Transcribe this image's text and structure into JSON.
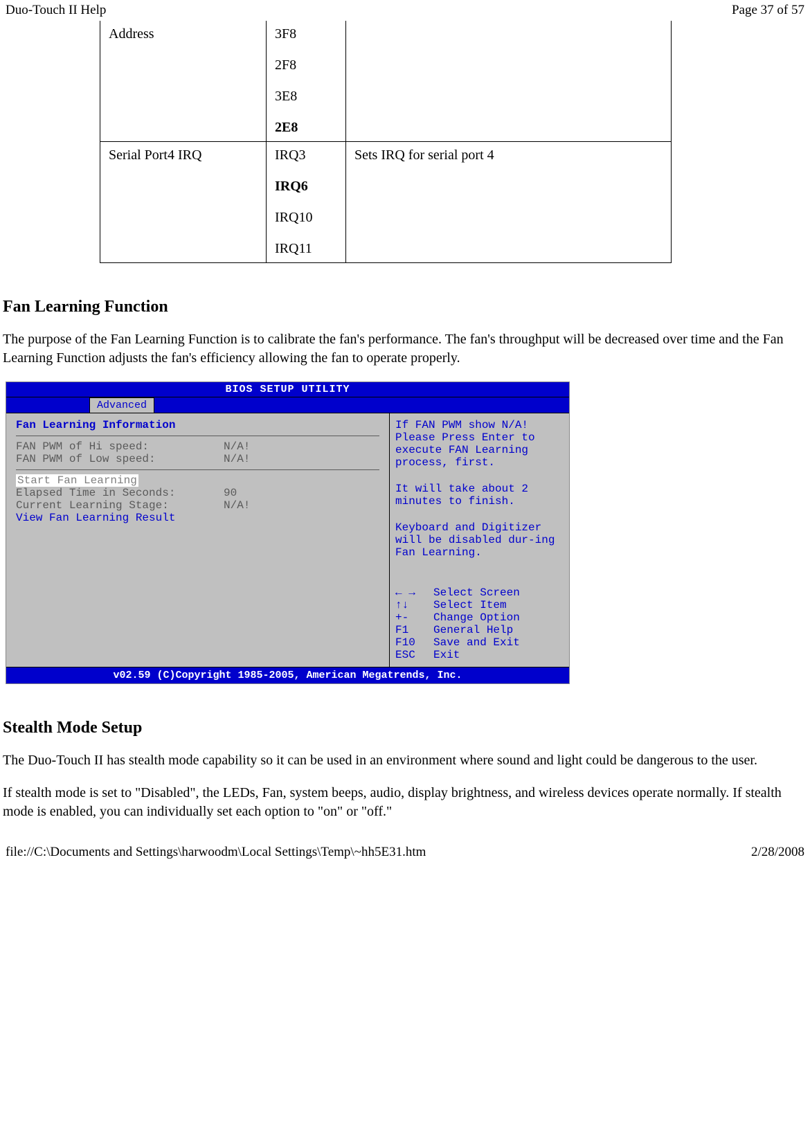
{
  "header": {
    "title": "Duo-Touch II Help",
    "page_info": "Page 37 of 57"
  },
  "table": {
    "row1": {
      "c1": "Address",
      "opts": {
        "o1": "3F8",
        "o2": "2F8",
        "o3": "3E8",
        "o4": "2E8"
      },
      "c3": ""
    },
    "row2": {
      "c1": "Serial Port4 IRQ",
      "opts": {
        "o1": "IRQ3",
        "o2": "IRQ6",
        "o3": "IRQ10",
        "o4": "IRQ11"
      },
      "c3": "Sets IRQ for serial port 4"
    }
  },
  "section1": {
    "heading": "Fan Learning Function",
    "p1": "The purpose of the Fan Learning Function is to calibrate the fan's performance.  The fan's throughput will be decreased over time and the Fan Learning Function adjusts the fan's efficiency allowing the fan to operate properly."
  },
  "bios": {
    "title": "BIOS SETUP UTILITY",
    "tab": "Advanced",
    "panel_title": "Fan Learning Information",
    "r1_label": "FAN PWM of Hi  speed:",
    "r1_val": "N/A!",
    "r2_label": "FAN PWM of Low speed:",
    "r2_val": "N/A!",
    "start": "Start Fan Learning",
    "r3_label": "Elapsed Time in Seconds:",
    "r3_val": "90",
    "r4_label": "Current Learning Stage:",
    "r4_val": "N/A!",
    "view": "View Fan Learning Result",
    "help1": "If FAN PWM show N/A! Please Press Enter to execute FAN Learning process, first.",
    "help2": "It will take about 2 minutes to finish.",
    "help3": "Keyboard and Digitizer will be disabled dur-ing Fan Learning.",
    "k1a": "← →",
    "k1b": "Select Screen",
    "k2a": "↑↓",
    "k2b": "Select Item",
    "k3a": "+-",
    "k3b": "Change Option",
    "k4a": "F1",
    "k4b": "General Help",
    "k5a": "F10",
    "k5b": "Save and Exit",
    "k6a": "ESC",
    "k6b": "Exit",
    "footer": "v02.59 (C)Copyright 1985-2005, American Megatrends, Inc."
  },
  "section2": {
    "heading": "Stealth Mode Setup",
    "p1": "The Duo-Touch II has stealth mode capability so it can be used in an environment where sound and light could be dangerous to the user.",
    "p2": "If stealth mode is set to \"Disabled\", the LEDs, Fan, system beeps, audio, display brightness, and wireless devices operate normally.  If stealth mode is enabled, you can individually set each option to \"on\" or \"off.\""
  },
  "footer": {
    "path": "file://C:\\Documents and Settings\\harwoodm\\Local Settings\\Temp\\~hh5E31.htm",
    "date": "2/28/2008"
  }
}
